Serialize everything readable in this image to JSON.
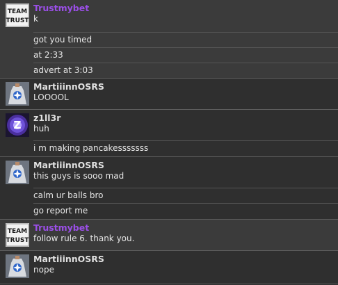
{
  "colors": {
    "staff": "#9b4fe8",
    "user": "#e0e0e0"
  },
  "groups": [
    {
      "author": "Trustmybet",
      "role": "staff",
      "avatar": "team-trust",
      "avatar_text": [
        "TEAM",
        "TRUST"
      ],
      "lines": [
        "k",
        "got you timed",
        "at 2:33",
        "advert at 3:03"
      ]
    },
    {
      "author": "MartiiinnOSRS",
      "role": "user",
      "avatar": "cape",
      "lines": [
        "LOOOOL"
      ]
    },
    {
      "author": "z1ll3r",
      "role": "user",
      "avatar": "z-orb",
      "lines": [
        "huh",
        "i m making pancakesssssss"
      ]
    },
    {
      "author": "MartiiinnOSRS",
      "role": "user",
      "avatar": "cape",
      "lines": [
        "this guys is sooo mad",
        "calm ur balls bro",
        "go report me"
      ]
    },
    {
      "author": "Trustmybet",
      "role": "staff",
      "avatar": "team-trust",
      "avatar_text": [
        "TEAM",
        "TRUST"
      ],
      "lines": [
        "follow rule 6. thank you."
      ]
    },
    {
      "author": "MartiiinnOSRS",
      "role": "user",
      "avatar": "cape",
      "lines": [
        "nope"
      ]
    }
  ]
}
